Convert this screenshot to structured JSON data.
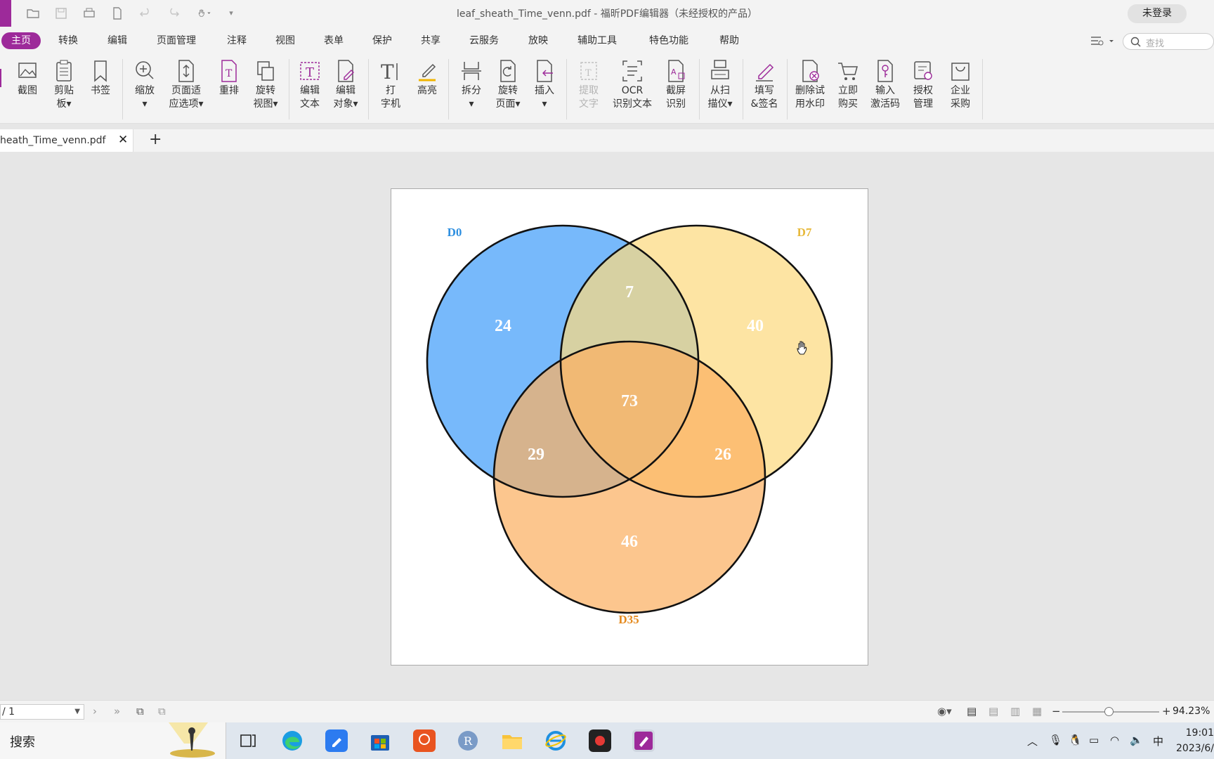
{
  "window": {
    "title": "leaf_sheath_Time_venn.pdf - 福昕PDF编辑器（未经授权的产品）",
    "login_label": "未登录"
  },
  "menu": {
    "items": [
      "主页",
      "转换",
      "编辑",
      "页面管理",
      "注释",
      "视图",
      "表单",
      "保护",
      "共享",
      "云服务",
      "放映",
      "辅助工具",
      "特色功能",
      "帮助"
    ],
    "active_index": 0,
    "search_placeholder": "查找"
  },
  "ribbon": {
    "tools": [
      {
        "l1": "截图",
        "l2": ""
      },
      {
        "l1": "剪贴",
        "l2": "板▾"
      },
      {
        "l1": "书签",
        "l2": ""
      },
      {
        "l1": "缩放",
        "l2": "▾"
      },
      {
        "l1": "页面适",
        "l2": "应选项▾"
      },
      {
        "l1": "重排",
        "l2": ""
      },
      {
        "l1": "旋转",
        "l2": "视图▾"
      },
      {
        "l1": "编辑",
        "l2": "文本"
      },
      {
        "l1": "编辑",
        "l2": "对象▾"
      },
      {
        "l1": "打",
        "l2": "字机"
      },
      {
        "l1": "高亮",
        "l2": ""
      },
      {
        "l1": "拆分",
        "l2": "▾"
      },
      {
        "l1": "旋转",
        "l2": "页面▾"
      },
      {
        "l1": "插入",
        "l2": "▾"
      },
      {
        "l1": "提取",
        "l2": "文字"
      },
      {
        "l1": "OCR",
        "l2": "识别文本"
      },
      {
        "l1": "截屏",
        "l2": "识别"
      },
      {
        "l1": "从扫",
        "l2": "描仪▾"
      },
      {
        "l1": "填写",
        "l2": "&签名"
      },
      {
        "l1": "删除试",
        "l2": "用水印"
      },
      {
        "l1": "立即",
        "l2": "购买"
      },
      {
        "l1": "输入",
        "l2": "激活码"
      },
      {
        "l1": "授权",
        "l2": "管理"
      },
      {
        "l1": "企业",
        "l2": "采购"
      }
    ]
  },
  "tabs": {
    "active_doc": "heath_Time_venn.pdf",
    "close_glyph": "✕",
    "new_glyph": "+"
  },
  "chart_data": {
    "type": "venn",
    "sets": [
      {
        "name": "D0",
        "color": "#2e8fe0",
        "fill": "#77b9fb"
      },
      {
        "name": "D7",
        "color": "#e7b93a",
        "fill": "#fcd97f"
      },
      {
        "name": "D35",
        "color": "#e58a1e",
        "fill": "#fbb062"
      }
    ],
    "regions": {
      "D0_only": 24,
      "D7_only": 40,
      "D35_only": 46,
      "D0_D7": 7,
      "D0_D35": 29,
      "D7_D35": 26,
      "D0_D7_D35": 73
    }
  },
  "status": {
    "page": "/ 1",
    "zoom": "94.23%"
  },
  "taskbar": {
    "search_placeholder": "搜索",
    "tray_ime": "中",
    "time": "19:01",
    "date": "2023/6/"
  }
}
